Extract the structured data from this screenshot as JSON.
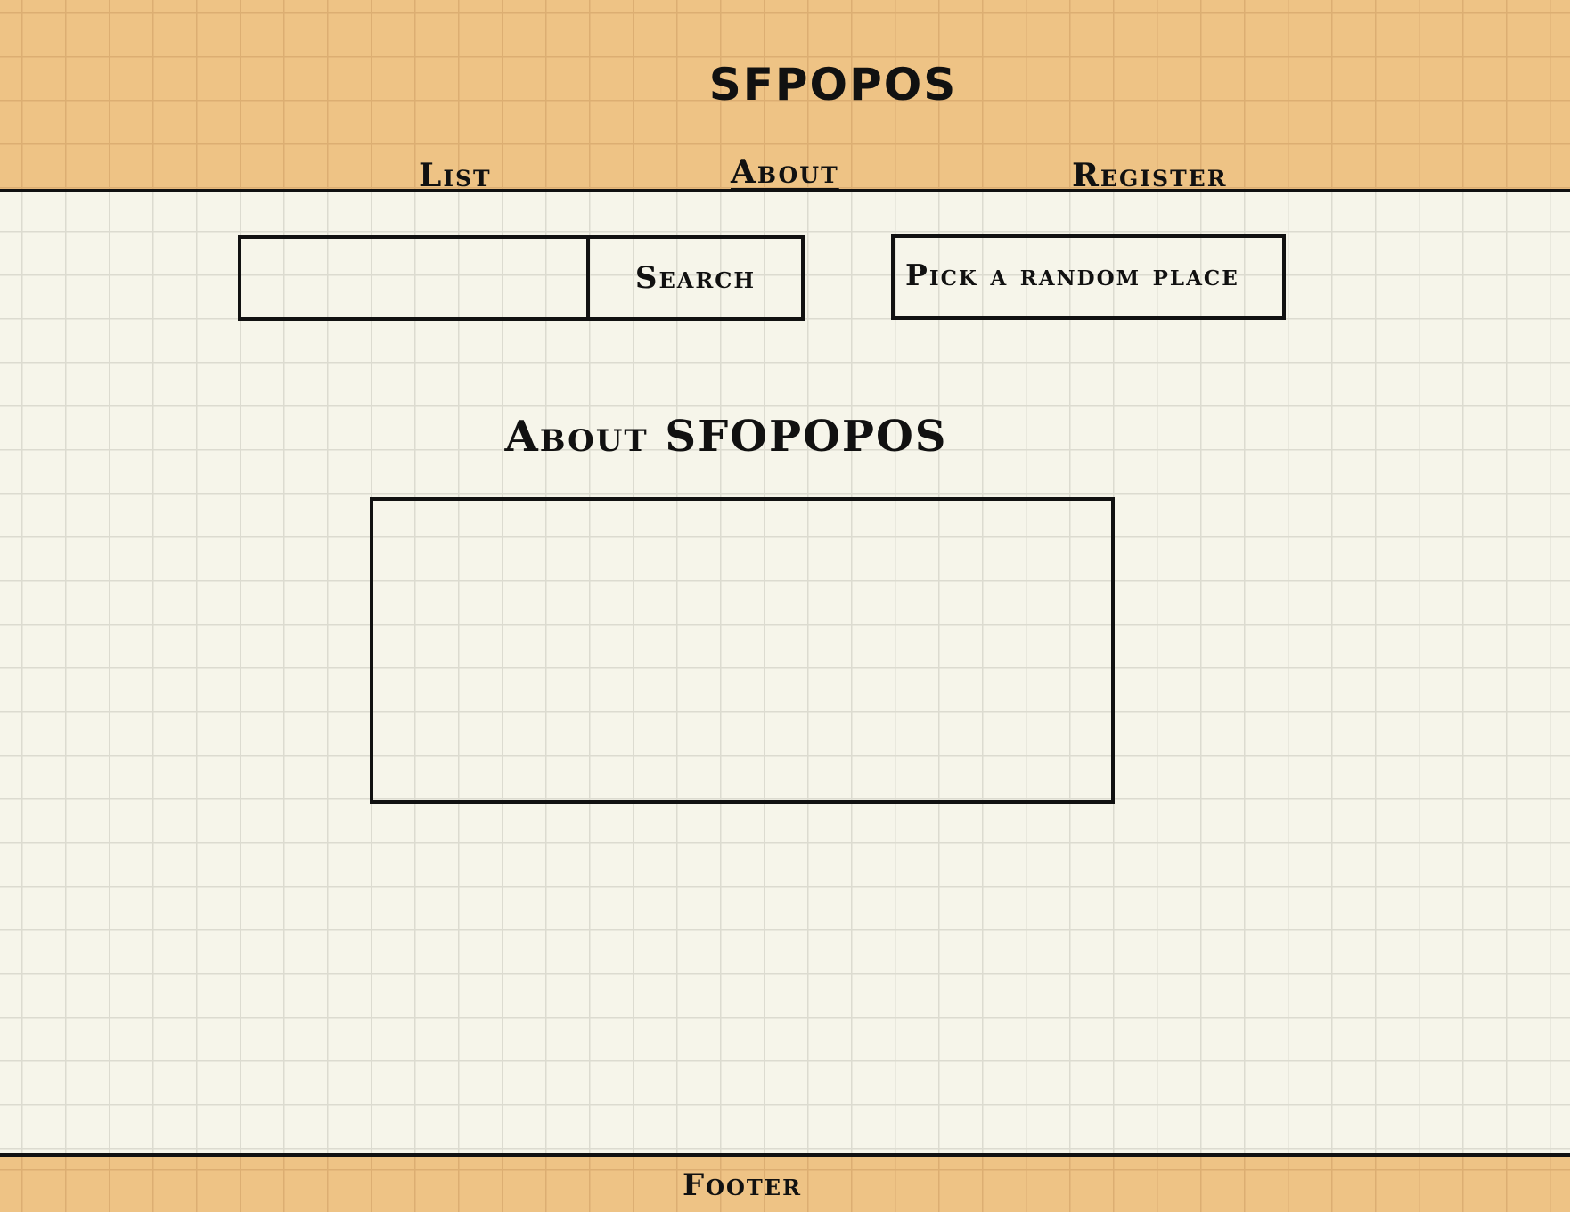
{
  "header": {
    "title": "SFPOPOS",
    "nav": {
      "list": "List",
      "about": "About",
      "register": "Register"
    },
    "active_nav": "about"
  },
  "search": {
    "value": "",
    "button_label": "Search"
  },
  "random_button_label": "Pick a random place",
  "about": {
    "title": "About SFOPOPOS",
    "content": ""
  },
  "footer": {
    "text": "Footer"
  },
  "colors": {
    "band": "#eec385",
    "paper": "#f6f5ea",
    "ink": "#111111"
  }
}
